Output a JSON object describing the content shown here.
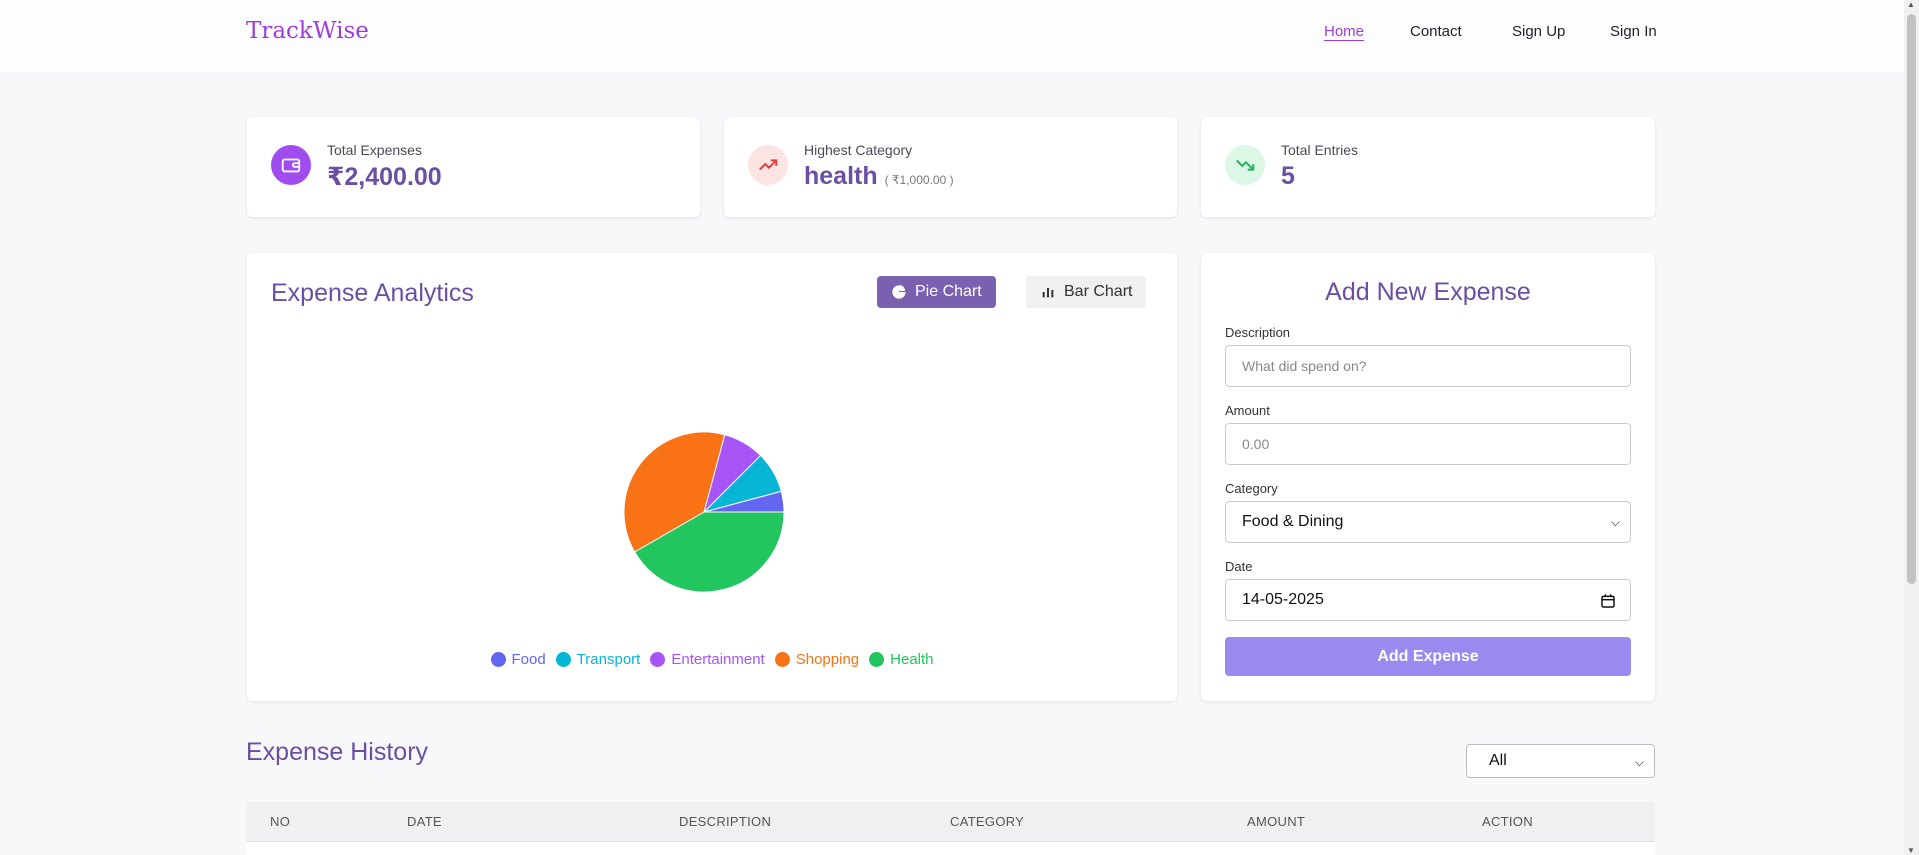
{
  "header": {
    "logo": "TrackWise",
    "nav": [
      "Home",
      "Contact",
      "Sign Up",
      "Sign In"
    ]
  },
  "stats": [
    {
      "label": "Total Expenses",
      "value": "₹2,400.00",
      "icon": "wallet-icon",
      "icon_color": "#a04df0"
    },
    {
      "label": "Highest Category",
      "value": "health",
      "sub": "( ₹1,000.00 )",
      "icon": "trending-up-icon",
      "icon_color": "#e2403f"
    },
    {
      "label": "Total Entries",
      "value": "5",
      "icon": "trending-down-icon",
      "icon_color": "#22b45a"
    }
  ],
  "analytics": {
    "title": "Expense Analytics",
    "pie_button": "Pie Chart",
    "bar_button": "Bar Chart"
  },
  "chart_data": {
    "type": "pie",
    "categories": [
      "Food",
      "Transport",
      "Entertainment",
      "Shopping",
      "Health"
    ],
    "values": [
      100,
      200,
      200,
      900,
      1000
    ],
    "colors": [
      "#6366f1",
      "#06b6d4",
      "#a855f7",
      "#f97316",
      "#22c55e"
    ],
    "legend_position": "bottom"
  },
  "form": {
    "title": "Add New Expense",
    "description_label": "Description",
    "description_placeholder": "What did spend on?",
    "amount_label": "Amount",
    "amount_placeholder": "0.00",
    "category_label": "Category",
    "category_value": "Food & Dining",
    "date_label": "Date",
    "date_value": "14-05-2025",
    "submit": "Add Expense"
  },
  "history": {
    "title": "Expense History",
    "filter_value": "All",
    "columns": [
      "NO",
      "DATE",
      "DESCRIPTION",
      "CATEGORY",
      "AMOUNT",
      "ACTION"
    ]
  }
}
